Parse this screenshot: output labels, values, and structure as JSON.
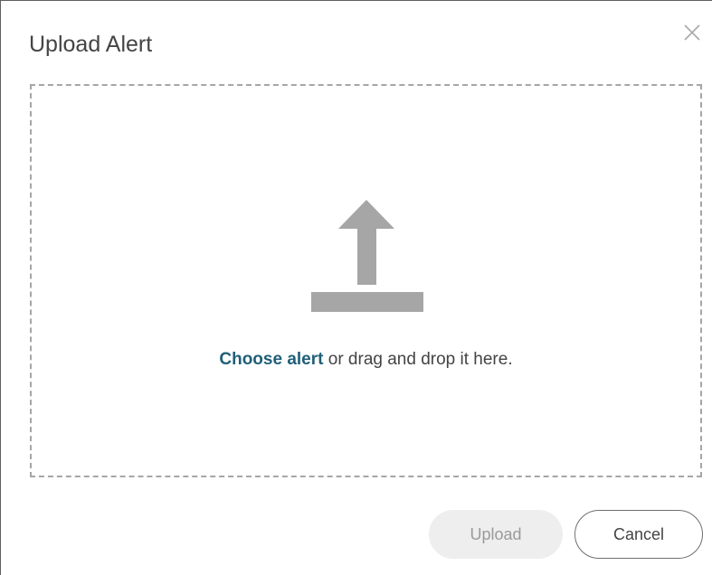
{
  "dialog": {
    "title": "Upload Alert",
    "close_icon": "close-icon"
  },
  "dropzone": {
    "icon": "upload-arrow-icon",
    "link_text": "Choose alert",
    "rest_text": " or drag and drop it here."
  },
  "footer": {
    "upload_label": "Upload",
    "upload_enabled": false,
    "cancel_label": "Cancel"
  },
  "colors": {
    "link": "#1f5f78",
    "icon": "#a6a6a6",
    "text": "#444444"
  }
}
